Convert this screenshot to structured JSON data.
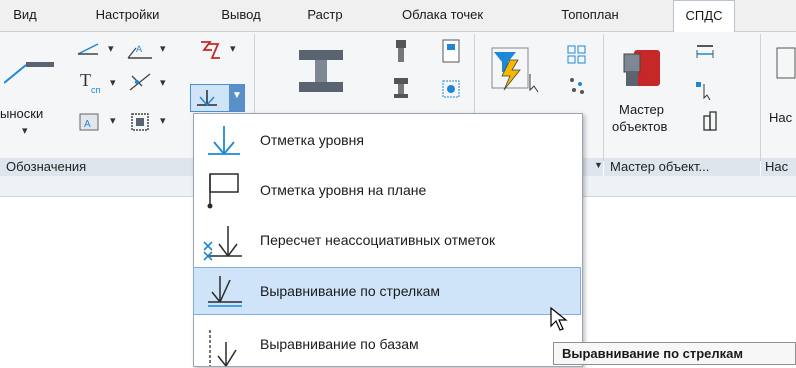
{
  "tabs": [
    {
      "label": "Вид"
    },
    {
      "label": "Настройки"
    },
    {
      "label": "Вывод"
    },
    {
      "label": "Растр"
    },
    {
      "label": "Облака точек"
    },
    {
      "label": "Топоплан"
    },
    {
      "label": "СПДС"
    }
  ],
  "active_tab": "СПДС",
  "ribbon": {
    "leaders_label": "ыноски",
    "wizard_label_line1": "Мастер",
    "wizard_label_line2": "объектов",
    "right_cut_label": "Нас",
    "groups": {
      "designations": "Обозначения",
      "wizard": "Мастер объект...",
      "right_cut": "Нас"
    }
  },
  "menu": {
    "items": [
      {
        "label": "Отметка уровня"
      },
      {
        "label": "Отметка уровня на плане"
      },
      {
        "label": "Пересчет неассоциативных отметок"
      },
      {
        "label": "Выравнивание по стрелкам"
      },
      {
        "label": "Выравнивание по базам"
      }
    ],
    "hovered_index": 3
  },
  "tooltip": {
    "text": "Выравнивание по стрелкам"
  },
  "colors": {
    "accent": "#1e88d8",
    "hover": "#cfe4f8",
    "dark": "#2b2b2b",
    "red": "#c62828"
  }
}
